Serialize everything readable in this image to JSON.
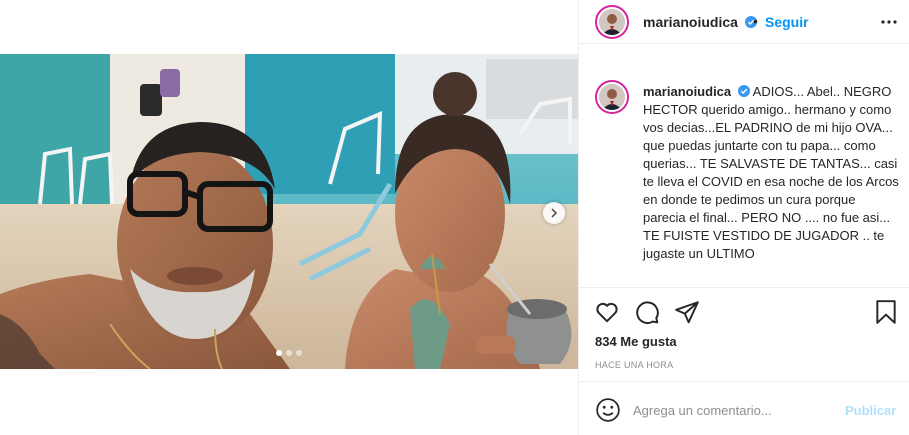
{
  "post": {
    "username": "marianoiudica",
    "follow_separator": "•",
    "follow_label": "Seguir",
    "caption_text": "ADIOS... Abel.. NEGRO HECTOR querido amigo.. hermano y como vos decias...EL PADRINO de mi hijo OVA... que puedas juntarte con tu papa... como querias... TE SALVASTE DE TANTAS... casi te lleva el COVID en esa noche de los Arcos en donde te pedimos un cura porque parecia el final... PERO NO .... no fue asi... TE FUISTE VESTIDO DE JUGADOR .. te jugaste un ULTIMO",
    "likes_text": "834 Me gusta",
    "time_text": "HACE UNA HORA"
  },
  "comment": {
    "placeholder": "Agrega un comentario...",
    "publish_label": "Publicar"
  },
  "carousel": {
    "slide_count": 3,
    "active_index": 0
  },
  "colors": {
    "accent": "#0095f6",
    "verified": "#3897f0",
    "publish_disabled": "#b2dffc",
    "story_ring": "#d6249f"
  },
  "icons": [
    "verified-icon",
    "more-options-icon",
    "heart-icon",
    "comment-icon",
    "share-icon",
    "bookmark-icon",
    "emoji-icon",
    "next-arrow-icon"
  ]
}
